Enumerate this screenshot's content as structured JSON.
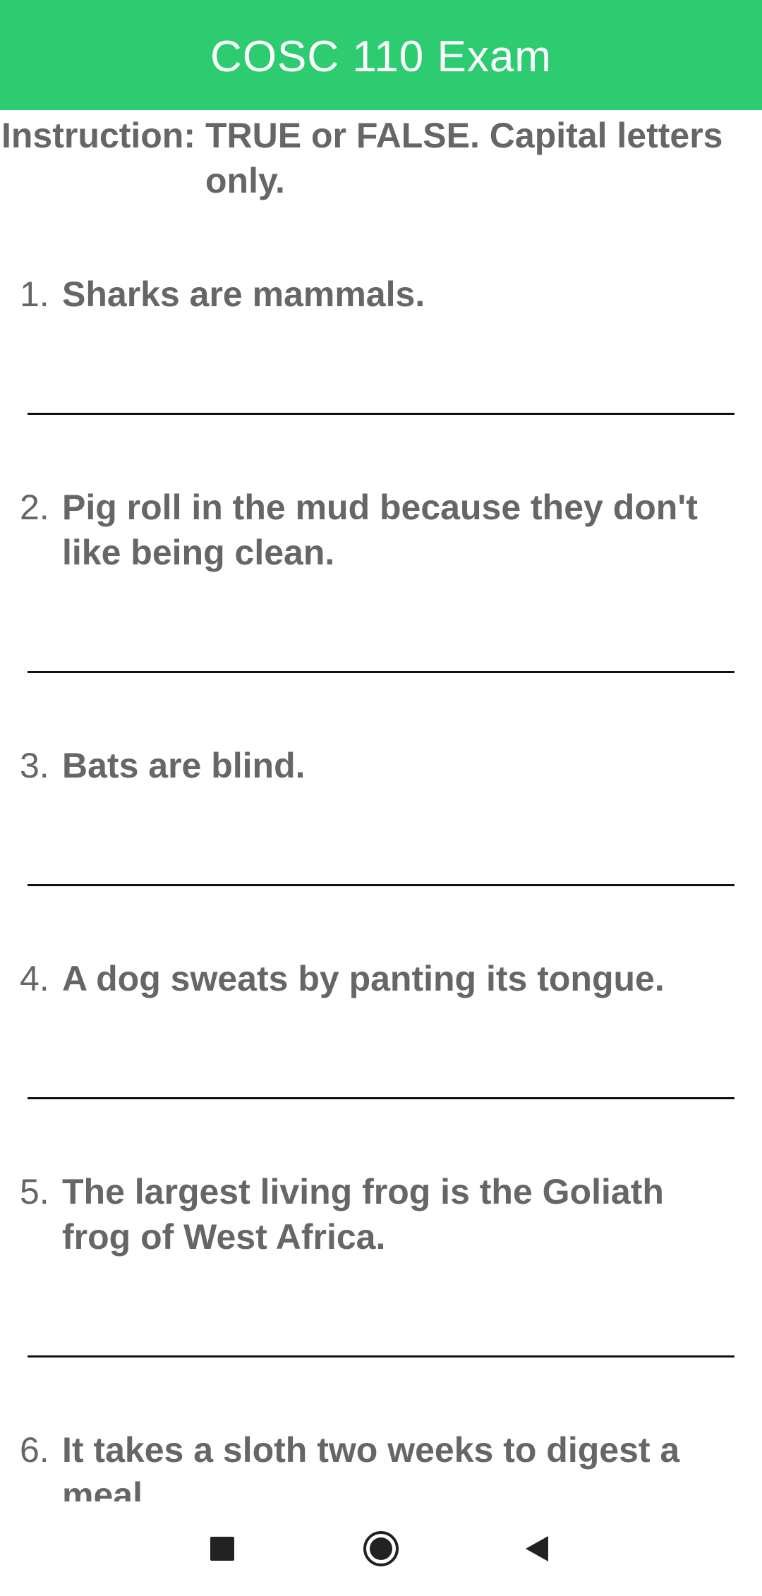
{
  "app_bar": {
    "title": "COSC 110 Exam"
  },
  "instruction": {
    "label": "Instruction:",
    "text": "TRUE or FALSE. Capital letters only."
  },
  "questions": [
    {
      "number": "1.",
      "text": "Sharks are mammals.",
      "answer": ""
    },
    {
      "number": "2.",
      "text": "Pig roll in the mud because they don't like being clean.",
      "answer": ""
    },
    {
      "number": "3.",
      "text": "Bats are blind.",
      "answer": ""
    },
    {
      "number": "4.",
      "text": "A dog sweats by panting its tongue.",
      "answer": ""
    },
    {
      "number": "5.",
      "text": "The largest living frog is the Goliath frog of West Africa.",
      "answer": ""
    },
    {
      "number": "6.",
      "text": "It takes a sloth two weeks to digest a meal.",
      "answer": ""
    }
  ],
  "nav_bar": {
    "recents_icon": "square-icon",
    "home_icon": "circle-icon",
    "back_icon": "triangle-left-icon",
    "icon_color": "#222222"
  },
  "colors": {
    "accent": "#2ecc71",
    "text": "#666666",
    "line": "#111111"
  }
}
